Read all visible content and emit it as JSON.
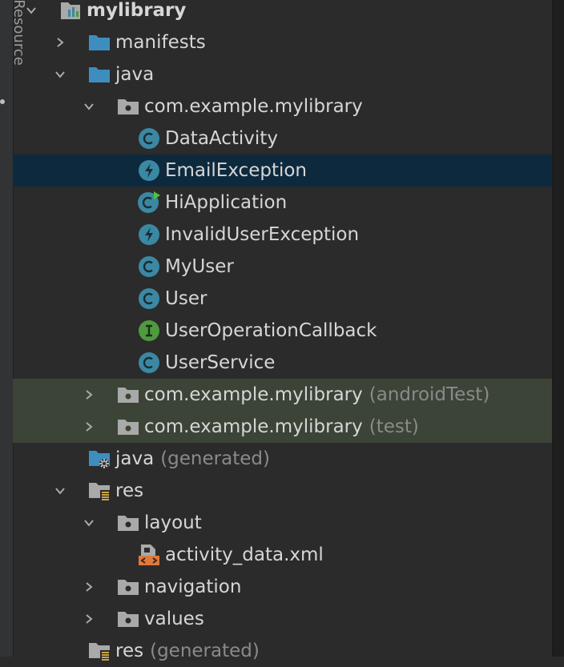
{
  "sidebar": {
    "label": "Resource"
  },
  "colors": {
    "folder": "#3e8dbf",
    "package": "#a9a9a9",
    "class_circle": "#3b88a3",
    "interface_circle": "#4e9a3f",
    "selected_row": "#0d293e",
    "test_row": "#3b4436",
    "xml": "#e0793a"
  },
  "tree": [
    {
      "label": "mylibrary",
      "icon": "module-icon",
      "expanded": true,
      "bold": true
    },
    {
      "label": "manifests",
      "icon": "folder-icon",
      "expanded": false
    },
    {
      "label": "java",
      "icon": "folder-icon",
      "expanded": true
    },
    {
      "label": "com.example.mylibrary",
      "icon": "package-icon",
      "expanded": true
    },
    {
      "label": "DataActivity",
      "icon": "class-icon"
    },
    {
      "label": "EmailException",
      "icon": "exception-icon",
      "selected": true
    },
    {
      "label": "HiApplication",
      "icon": "runnable-class-icon"
    },
    {
      "label": "InvalidUserException",
      "icon": "exception-icon"
    },
    {
      "label": "MyUser",
      "icon": "class-icon"
    },
    {
      "label": "User",
      "icon": "class-icon"
    },
    {
      "label": "UserOperationCallback",
      "icon": "interface-icon"
    },
    {
      "label": "UserService",
      "icon": "class-icon"
    },
    {
      "label": "com.example.mylibrary",
      "suffix": "(androidTest)",
      "icon": "package-icon",
      "expanded": false
    },
    {
      "label": "com.example.mylibrary",
      "suffix": "(test)",
      "icon": "package-icon",
      "expanded": false
    },
    {
      "label": "java",
      "suffix": "(generated)",
      "icon": "generated-folder-icon"
    },
    {
      "label": "res",
      "icon": "res-folder-icon",
      "expanded": true
    },
    {
      "label": "layout",
      "icon": "package-icon",
      "expanded": true
    },
    {
      "label": "activity_data.xml",
      "icon": "layout-xml-icon"
    },
    {
      "label": "navigation",
      "icon": "package-icon",
      "expanded": false
    },
    {
      "label": "values",
      "icon": "package-icon",
      "expanded": false
    },
    {
      "label": "res",
      "suffix": "(generated)",
      "icon": "res-folder-icon"
    }
  ]
}
